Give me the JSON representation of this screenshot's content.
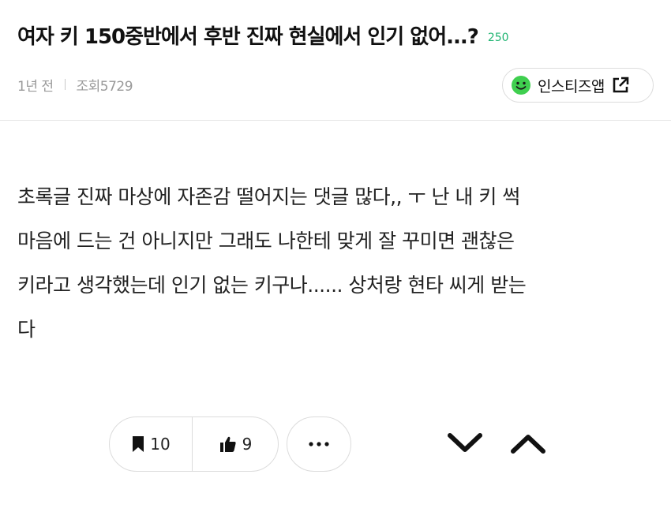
{
  "post": {
    "title": "여자 키 150중반에서 후반 진짜 현실에서 인기 없어...?",
    "comment_count": "250",
    "time_ago": "1년 전",
    "views": "조회5729",
    "app_button_label": "인스티즈앱",
    "body_lines": [
      "초록글 진짜 마상에 자존감 떨어지는 댓글 많다,, ㅜ 난 내 키 썩",
      "마음에 드는 건 아니지만 그래도 나한테 맞게 잘 꾸미면 괜찮은",
      "키라고 생각했는데 인기 없는 키구나...... 상처랑 현타 씨게 받는",
      "다"
    ]
  },
  "actions": {
    "scrap_count": "10",
    "like_count": "9"
  },
  "icons": {
    "app_logo": "smiley-icon",
    "external": "external-link-icon",
    "scrap": "bookmark-icon",
    "like": "thumbs-up-icon",
    "more": "more-dots-icon",
    "prev": "chevron-down-icon",
    "next": "chevron-up-icon"
  },
  "colors": {
    "accent": "#22b573",
    "logo_green": "#3fcf4f"
  }
}
